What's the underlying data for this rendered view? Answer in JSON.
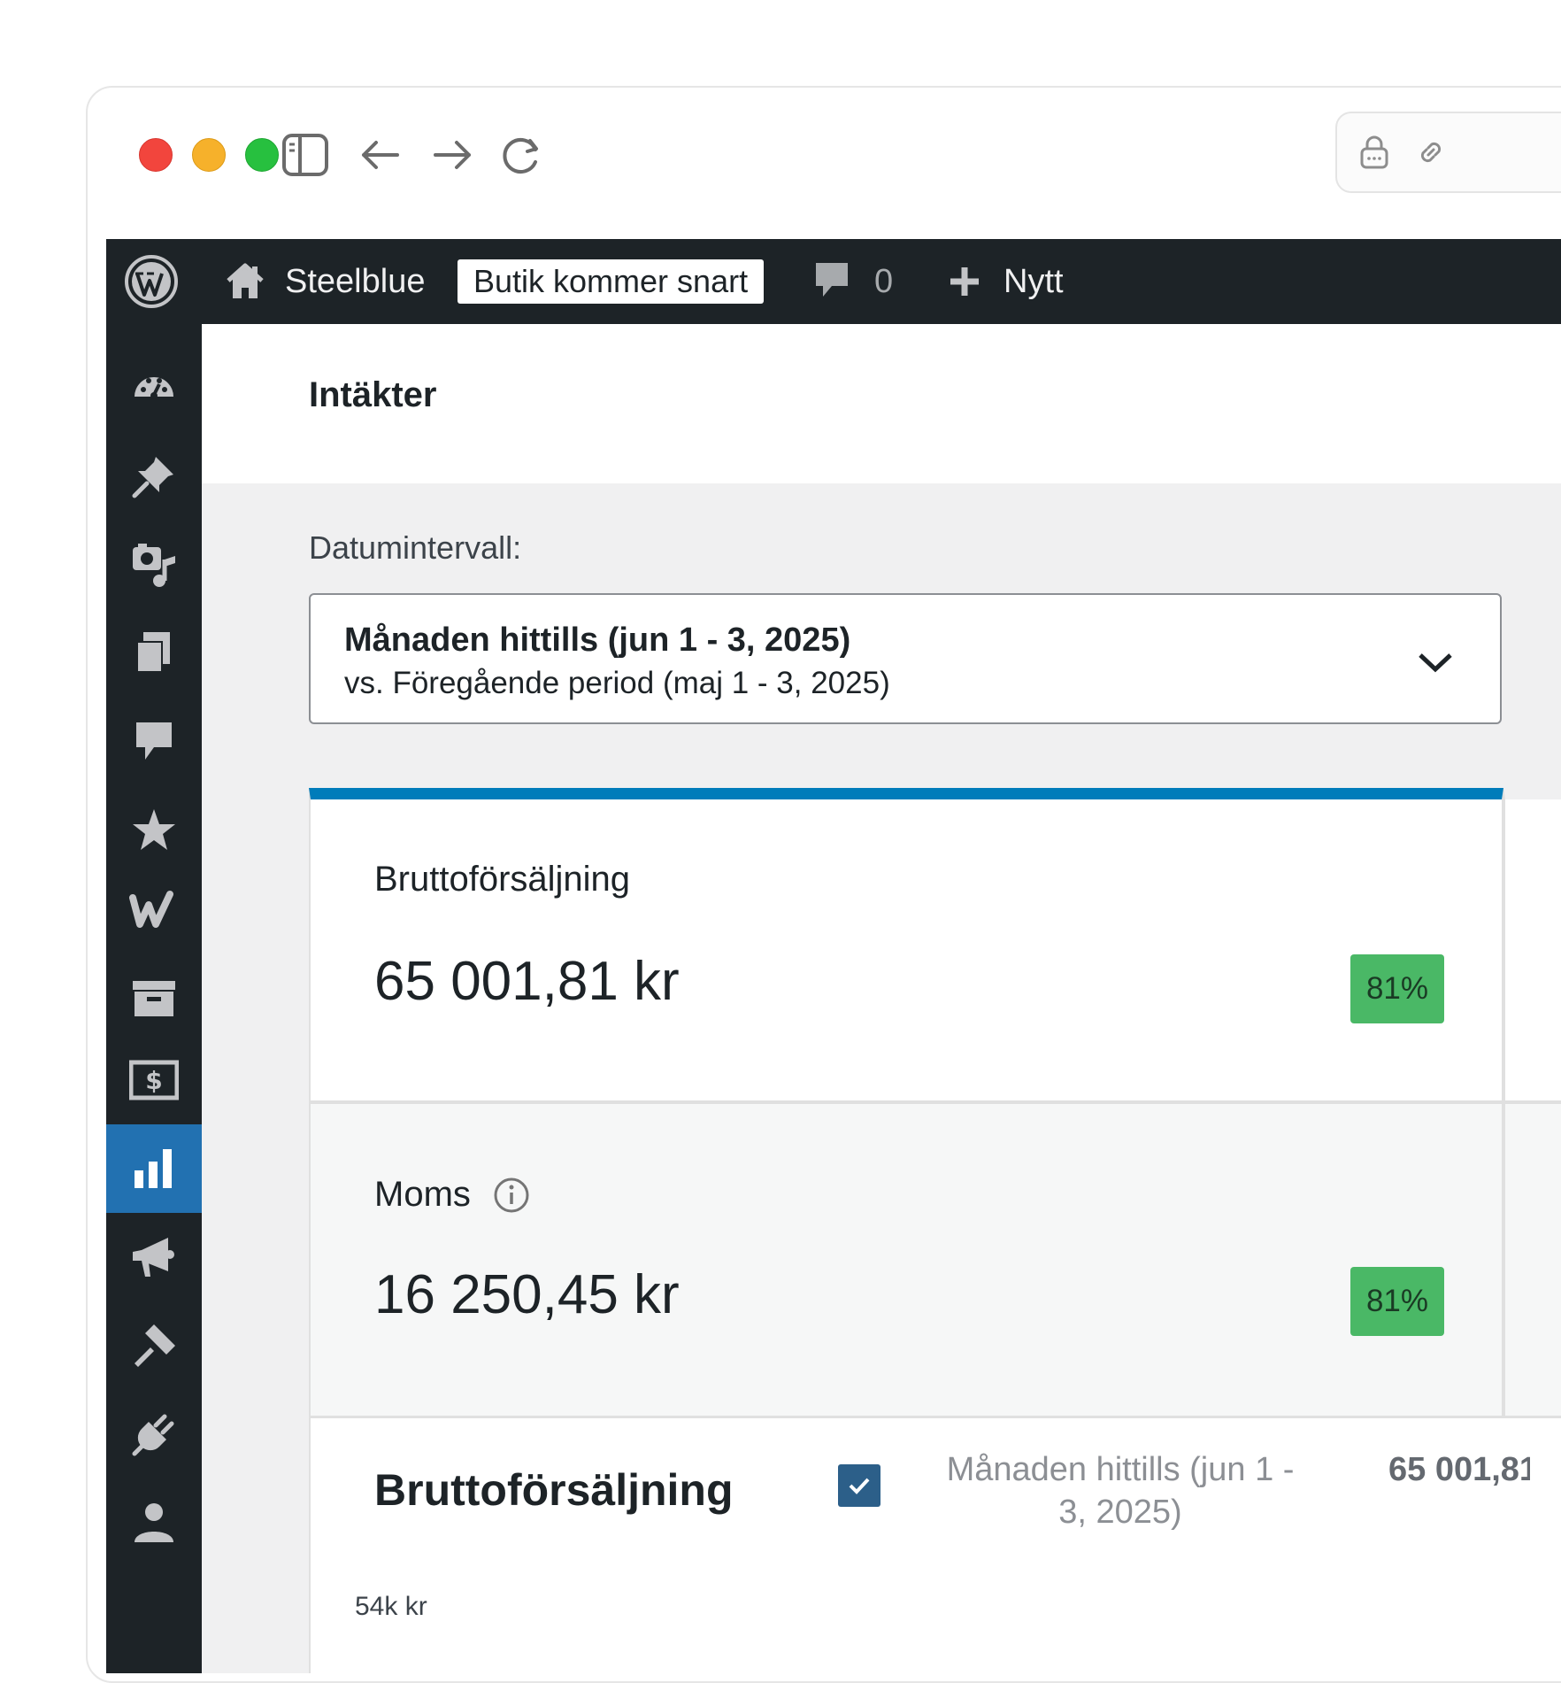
{
  "browser": {
    "traffic_lights": [
      "close",
      "minimize",
      "zoom"
    ],
    "toolbar_icons": [
      "sidebar-toggle-icon",
      "back-arrow-icon",
      "forward-arrow-icon",
      "reload-icon"
    ],
    "url_icons": [
      "lock-icon",
      "link-icon"
    ]
  },
  "adminbar": {
    "site_name": "Steelblue",
    "badge": "Butik kommer snart",
    "comments_count": "0",
    "new_label": "Nytt"
  },
  "sidebar": {
    "items": [
      {
        "icon": "dashboard-icon"
      },
      {
        "icon": "pin-icon"
      },
      {
        "icon": "media-icon"
      },
      {
        "icon": "pages-icon"
      },
      {
        "icon": "comments-icon"
      },
      {
        "icon": "star-icon"
      },
      {
        "icon": "woocommerce-icon"
      },
      {
        "icon": "archive-icon"
      },
      {
        "icon": "payments-icon"
      },
      {
        "icon": "analytics-icon",
        "active": true
      },
      {
        "icon": "megaphone-icon"
      },
      {
        "icon": "appearance-icon"
      },
      {
        "icon": "plugins-icon"
      },
      {
        "icon": "users-icon"
      }
    ]
  },
  "page": {
    "title": "Intäkter",
    "date_range_label": "Datumintervall:",
    "date_range_primary": "Månaden hittills (jun 1 - 3, 2025)",
    "date_range_compare": "vs. Föregående period (maj 1 - 3, 2025)"
  },
  "summary": [
    {
      "label": "Bruttoförsäljning",
      "value": "65 001,81 kr",
      "delta": "81%",
      "info_icon": false
    },
    {
      "label": "Moms",
      "value": "16 250,45 kr",
      "delta": "81%",
      "info_icon": true
    }
  ],
  "chart_panel": {
    "title": "Bruttoförsäljning",
    "period": "Månaden hittills (jun 1 - 3, 2025)",
    "total": "65 001,81",
    "y_tick_top": "54k kr"
  },
  "colors": {
    "admin_dark": "#1d2327",
    "accent_blue": "#007cba",
    "active_menu": "#2271b1",
    "delta_green": "#4ab866",
    "checkbox": "#2c5f89"
  }
}
